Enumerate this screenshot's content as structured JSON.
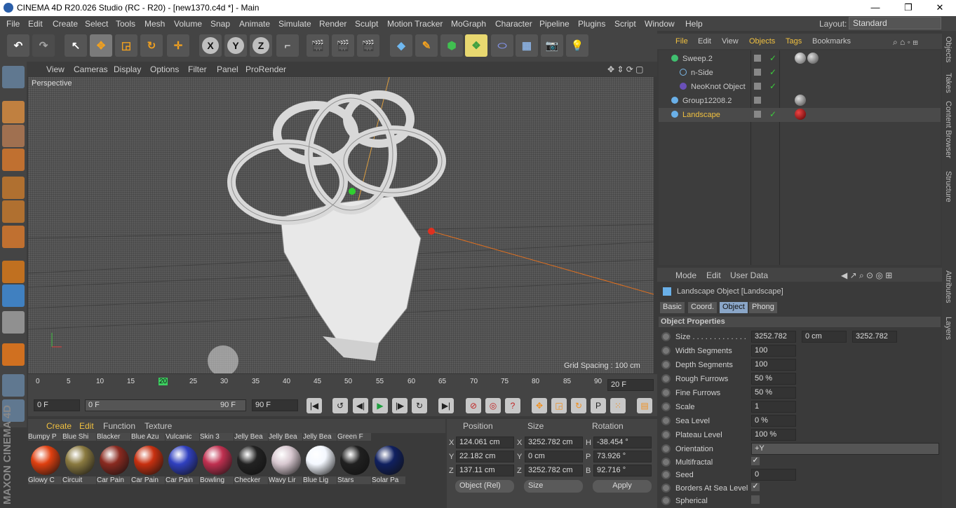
{
  "window": {
    "title": "CINEMA 4D R20.026 Studio (RC - R20) - [new1370.c4d *] - Main",
    "controls": [
      "—",
      "❐",
      "✕"
    ]
  },
  "menubar": {
    "items": [
      "File",
      "Edit",
      "Create",
      "Select",
      "Tools",
      "Mesh",
      "Volume",
      "Snap",
      "Animate",
      "Simulate",
      "Render",
      "Sculpt",
      "Motion Tracker",
      "MoGraph",
      "Character",
      "Pipeline",
      "Plugins",
      "Script",
      "Window",
      "Help"
    ],
    "layout_label": "Layout:",
    "layout_value": "Standard"
  },
  "toolbar": {
    "axis_x": "X",
    "axis_y": "Y",
    "axis_z": "Z"
  },
  "viewport": {
    "menu": [
      "View",
      "Cameras",
      "Display",
      "Options",
      "Filter",
      "Panel",
      "ProRender"
    ],
    "label": "Perspective",
    "grid_spacing": "Grid Spacing : 100 cm"
  },
  "timeline": {
    "ticks": [
      "0",
      "5",
      "10",
      "15",
      "20",
      "25",
      "30",
      "35",
      "40",
      "45",
      "50",
      "55",
      "60",
      "65",
      "70",
      "75",
      "80",
      "85",
      "90"
    ],
    "current_frame": "20 F",
    "start": "0 F",
    "range_start": "0 F",
    "range_end": "90 F",
    "end": "90 F"
  },
  "materials": {
    "menu": [
      "Create",
      "Edit",
      "Function",
      "Texture"
    ],
    "top_names": [
      "Bumpy P",
      "Blue Shi",
      "Blacker",
      "Blue Azu",
      "Vulcanic",
      "Skin 3",
      "Jelly Bea",
      "Jelly Bea",
      "Jelly Bea",
      "Green F"
    ],
    "names": [
      "Glowy C",
      "Circuit",
      "Car Pain",
      "Car Pain",
      "Car Pain",
      "Bowling",
      "Checker",
      "Wavy Lir",
      "Blue Lig",
      "Stars",
      "Solar Pa"
    ],
    "colors": [
      "#e04010",
      "#8a7a40",
      "#8a2a20",
      "#c83010",
      "#3040c0",
      "#c03050",
      "#222222",
      "#d8c8d0",
      "#f4f8ff",
      "#202020",
      "#102060"
    ]
  },
  "coords": {
    "headers": [
      "Position",
      "Size",
      "Rotation"
    ],
    "rows": [
      {
        "axis": "X",
        "pos": "124.061 cm",
        "size_axis": "X",
        "size": "3252.782 cm",
        "rot_axis": "H",
        "rot": "-38.454 °"
      },
      {
        "axis": "Y",
        "pos": "22.182 cm",
        "size_axis": "Y",
        "size": "0 cm",
        "rot_axis": "P",
        "rot": "73.926 °"
      },
      {
        "axis": "Z",
        "pos": "137.11 cm",
        "size_axis": "Z",
        "size": "3252.782 cm",
        "rot_axis": "B",
        "rot": "92.716 °"
      }
    ],
    "mode": "Object (Rel)",
    "size_mode": "Size",
    "apply": "Apply"
  },
  "object_manager": {
    "menu": [
      "File",
      "Edit",
      "View",
      "Objects",
      "Tags",
      "Bookmarks"
    ],
    "objects": [
      {
        "name": "Sweep.2",
        "color": "#7ab8e8",
        "highlight": false
      },
      {
        "name": "n-Side",
        "color": "#7ab8e8",
        "highlight": false
      },
      {
        "name": "NeoKnot Object",
        "color": "#7a60c8",
        "highlight": false
      },
      {
        "name": "Group12208.2",
        "color": "#7ab8e8",
        "highlight": false
      },
      {
        "name": "Landscape",
        "color": "#f0c040",
        "highlight": true
      }
    ]
  },
  "attributes": {
    "menu": [
      "Mode",
      "Edit",
      "User Data"
    ],
    "object_title": "Landscape Object [Landscape]",
    "tabs": [
      "Basic",
      "Coord.",
      "Object",
      "Phong"
    ],
    "section": "Object Properties",
    "size": [
      "3252.782",
      "0 cm",
      "3252.782"
    ],
    "props": [
      {
        "label": "Width Segments",
        "value": "100"
      },
      {
        "label": "Depth Segments",
        "value": "100"
      },
      {
        "label": "Rough Furrows",
        "value": "50 %"
      },
      {
        "label": "Fine Furrows",
        "value": "50 %"
      },
      {
        "label": "Scale",
        "value": "1"
      },
      {
        "label": "Sea Level",
        "value": "0 %"
      },
      {
        "label": "Plateau Level",
        "value": "100 %"
      }
    ],
    "orientation_label": "Orientation",
    "orientation_value": "+Y",
    "multifractal_label": "Multifractal",
    "seed_label": "Seed",
    "seed_value": "0",
    "borders_label": "Borders At Sea Level",
    "spherical_label": "Spherical"
  },
  "side_tabs": [
    "Objects",
    "Takes",
    "Content Browser",
    "Structure",
    "Attributes",
    "Layers"
  ],
  "brand": "MAXON CINEMA 4D"
}
